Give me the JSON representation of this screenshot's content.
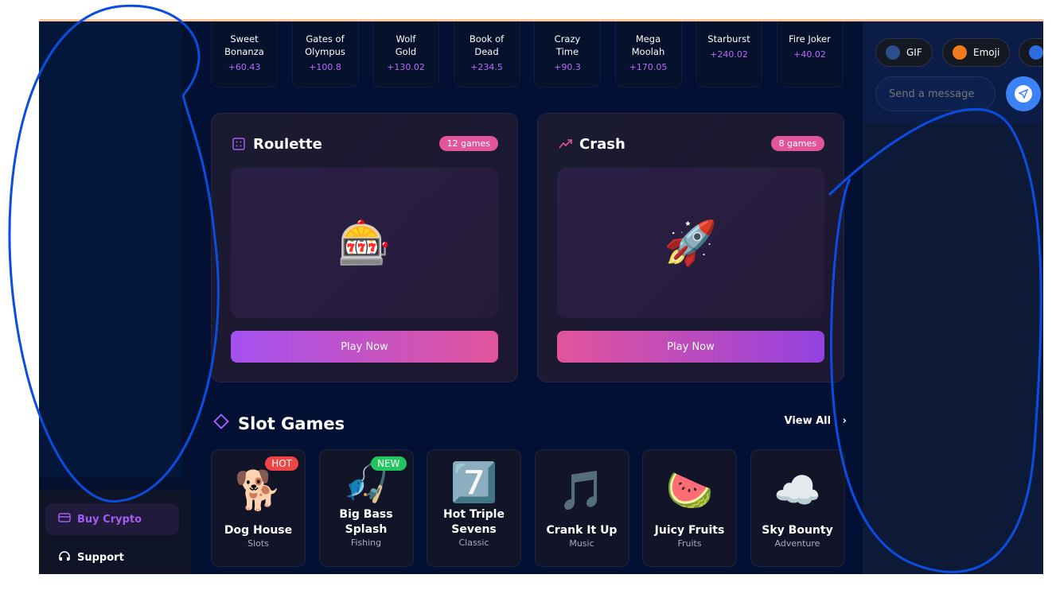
{
  "recent_wins": [
    {
      "name": "Sweet\nBonanza",
      "l1": "Sweet",
      "l2": "Bonanza",
      "amount": "+60.43"
    },
    {
      "l1": "Gates of",
      "l2": "Olympus",
      "amount": "+100.8"
    },
    {
      "l1": "Wolf",
      "l2": "Gold",
      "amount": "+130.02"
    },
    {
      "l1": "Book of",
      "l2": "Dead",
      "amount": "+234.5"
    },
    {
      "l1": "Crazy",
      "l2": "Time",
      "amount": "+90.3"
    },
    {
      "l1": "Mega",
      "l2": "Moolah",
      "amount": "+170.05"
    },
    {
      "l1": "Starburst",
      "l2": "",
      "amount": "+240.02"
    },
    {
      "l1": "Fire Joker",
      "l2": "",
      "amount": "+40.02"
    }
  ],
  "categories": [
    {
      "title": "Roulette",
      "count": "12 games",
      "emoji": "🎰",
      "play": "Play Now"
    },
    {
      "title": "Crash",
      "count": "8 games",
      "emoji": "🚀",
      "play": "Play Now"
    }
  ],
  "slots": {
    "title": "Slot Games",
    "view_all": "View All",
    "items": [
      {
        "name": "Dog House",
        "genre": "Slots",
        "emoji": "🐕",
        "tag": "HOT"
      },
      {
        "name": "Big Bass Splash",
        "genre": "Fishing",
        "emoji": "🎣",
        "tag": "NEW"
      },
      {
        "name": "Hot Triple Sevens",
        "genre": "Classic",
        "emoji": "7️⃣"
      },
      {
        "name": "Crank It Up",
        "genre": "Music",
        "emoji": "🎵"
      },
      {
        "name": "Juicy Fruits",
        "genre": "Fruits",
        "emoji": "🍉"
      },
      {
        "name": "Sky Bounty",
        "genre": "Adventure",
        "emoji": "☁️"
      }
    ]
  },
  "sidebar": {
    "buy_crypto": "Buy Crypto",
    "support": "Support"
  },
  "chat": {
    "gif": "GIF",
    "emoji": "Emoji",
    "placeholder": "Send a message"
  },
  "colors": {
    "accent": "#a35cf0",
    "pink": "#e2559a",
    "send": "#3b82f6"
  }
}
